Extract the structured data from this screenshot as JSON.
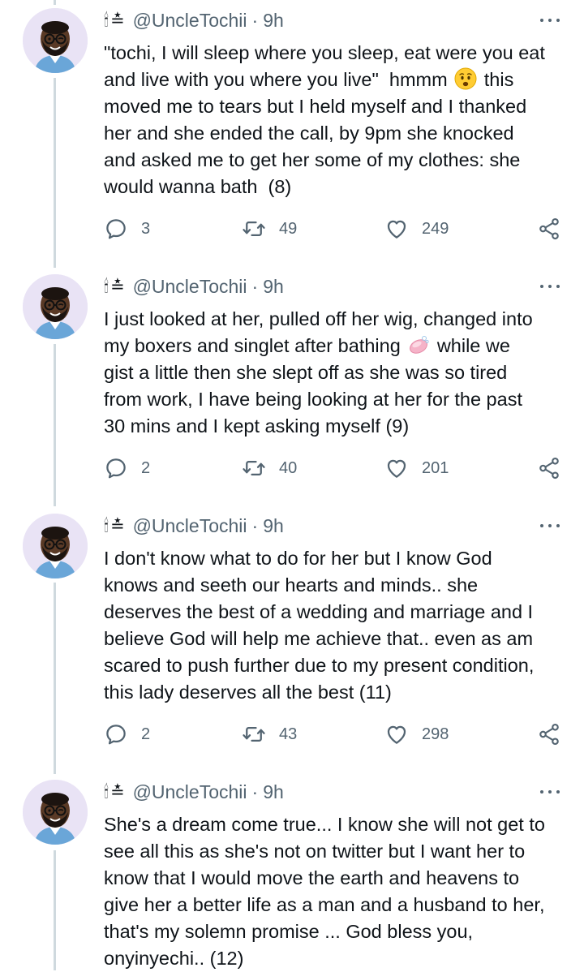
{
  "colors": {
    "text": "#0f1419",
    "muted": "#536471",
    "thread_line": "#cfd9de",
    "avatar_bg": "#e9e3f5"
  },
  "tweets": [
    {
      "badges": "🕯≛",
      "handle": "@UncleTochii",
      "time": "9h",
      "text_before_emoji": "\"tochi, I will sleep where you sleep, eat were you eat\nand live with you where you live\"  hmmm ",
      "emoji": "worried-face",
      "text_after_emoji": " this\nmoved me to tears but I held myself and I thanked\nher and she ended the call, by 9pm she knocked\nand asked me to get her some of my clothes: she\nwould wanna bath  (8)",
      "replies": "3",
      "retweets": "49",
      "likes": "249"
    },
    {
      "badges": "🕯≛",
      "handle": "@UncleTochii",
      "time": "9h",
      "text_before_emoji": "I just looked at her, pulled off her wig, changed into\nmy boxers and singlet after bathing ",
      "emoji": "soap",
      "text_after_emoji": " while we\ngist a little then she slept off as she was so tired\nfrom work, I have being looking at her for the past\n30 mins and I kept asking myself (9)",
      "replies": "2",
      "retweets": "40",
      "likes": "201"
    },
    {
      "badges": "🕯≛",
      "handle": "@UncleTochii",
      "time": "9h",
      "text": "I don't know what to do for her but I know God\nknows and seeth our hearts and minds.. she\ndeserves the best of a wedding and marriage and I\nbelieve God will help me achieve that.. even as am\nscared to push further due to my present condition,\nthis lady deserves all the best (11)",
      "replies": "2",
      "retweets": "43",
      "likes": "298"
    },
    {
      "badges": "🕯≛",
      "handle": "@UncleTochii",
      "time": "9h",
      "text": "She's a dream come true... I know she will not get to\nsee all this as she's not on twitter but I want her to\nknow that I would move the earth and heavens to\ngive her a better life as a man and a husband to her,\nthat's my solemn promise ... God bless you,\nonyinyechi.. (12)"
    }
  ]
}
